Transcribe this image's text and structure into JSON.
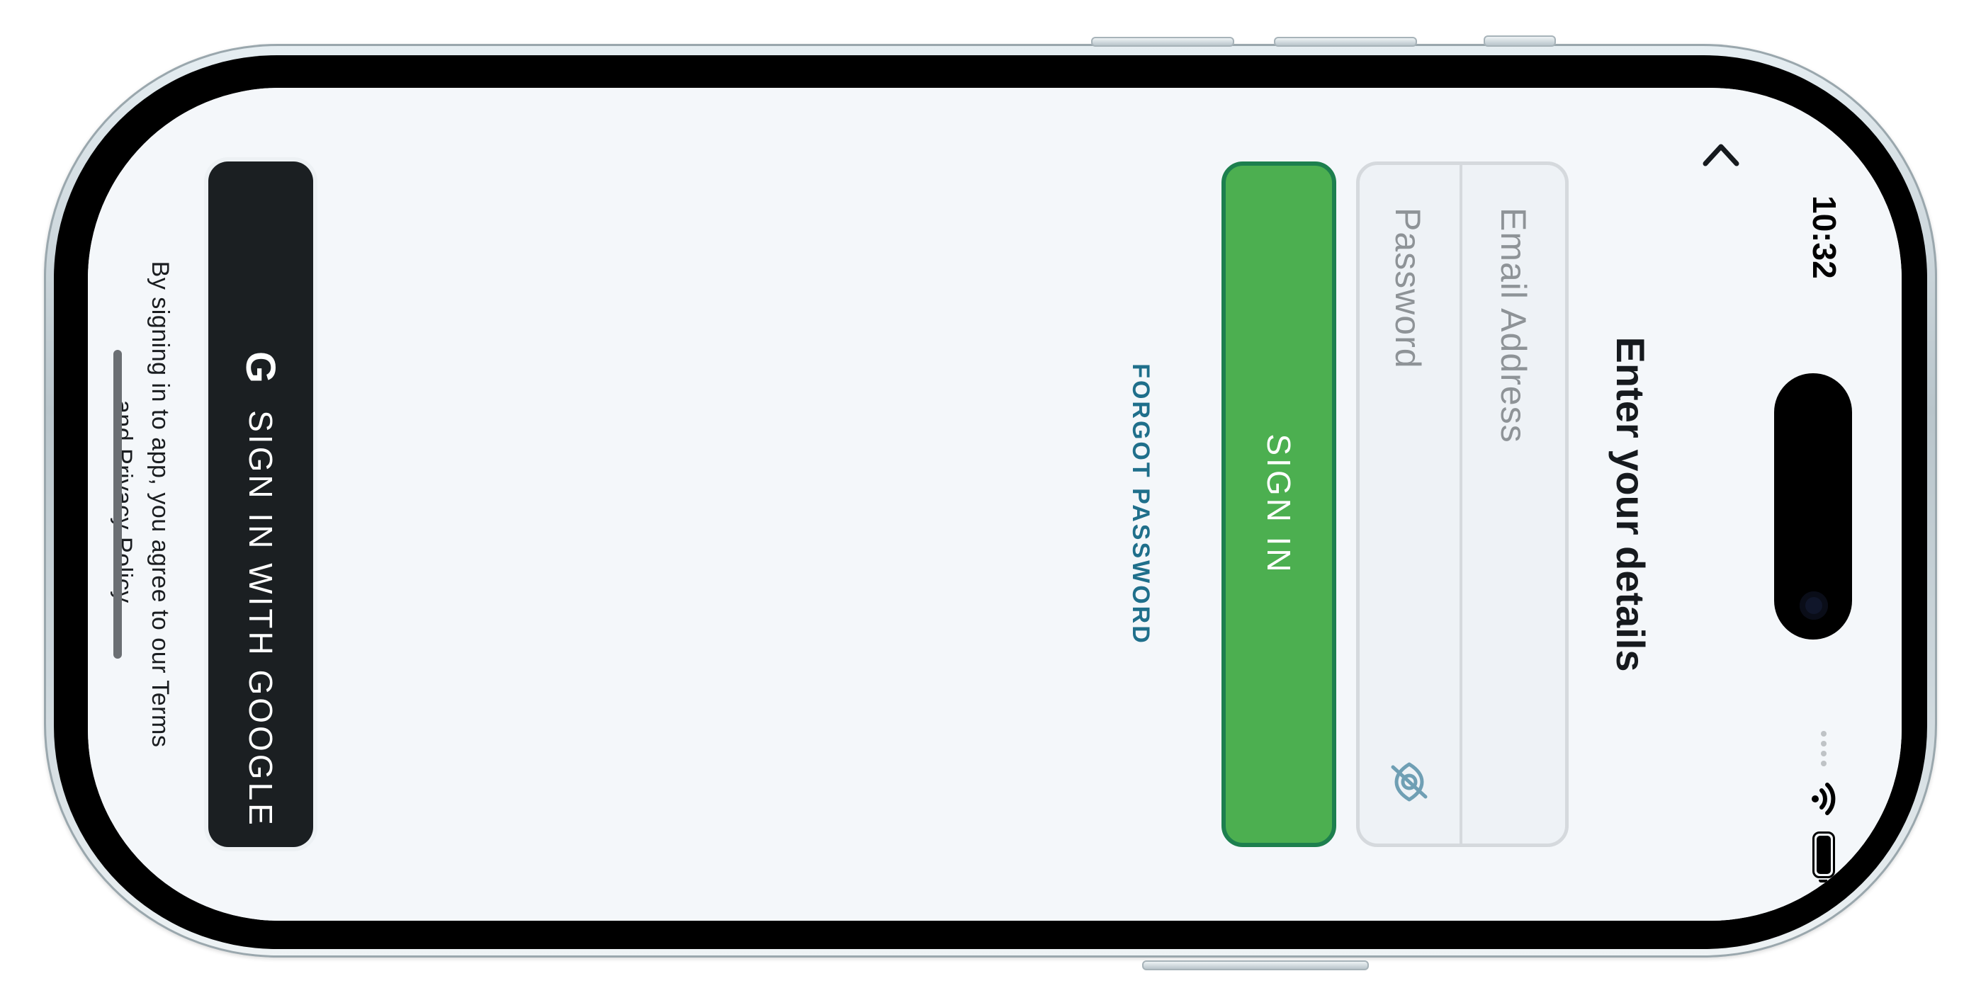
{
  "status_bar": {
    "time": "10:32",
    "wifi_icon": "wifi-icon",
    "battery_icon": "battery-icon"
  },
  "header": {
    "back_icon": "chevron-left-icon",
    "title": "Enter your details"
  },
  "form": {
    "email": {
      "value": "",
      "placeholder": "Email Address"
    },
    "password": {
      "value": "",
      "placeholder": "Password",
      "toggle_icon": "eye-slash-icon"
    }
  },
  "actions": {
    "sign_in_label": "SIGN IN",
    "forgot_password_label": "FORGOT PASSWORD",
    "google_icon_glyph": "G",
    "google_label": "SIGN IN WITH GOOGLE"
  },
  "legal": {
    "text": "By signing in to app, you agree to our Terms and Privacy Policy."
  },
  "colors": {
    "primary_green": "#4caf50",
    "primary_green_border": "#1d7f4e",
    "link_blue": "#1f6f8b",
    "google_button_bg": "#1b1f22",
    "screen_bg": "#f4f7fa"
  }
}
